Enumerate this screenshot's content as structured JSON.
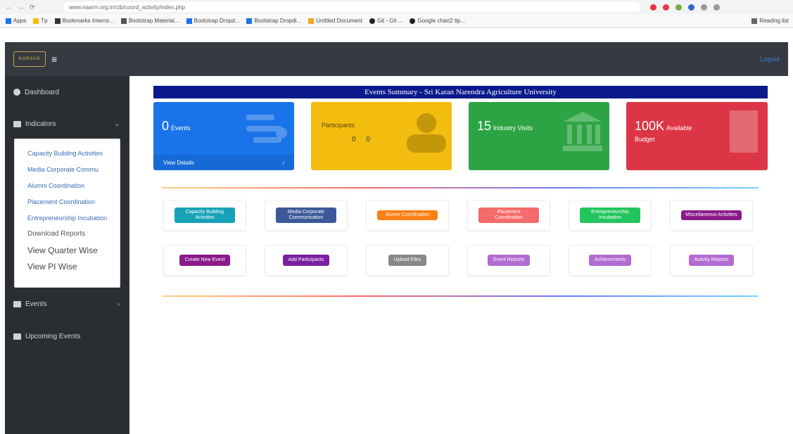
{
  "browser": {
    "url": "www.naarm.org.in/ctb/coord_activity/index.php",
    "bookmarks": [
      "Apps",
      "Tp",
      "Bookmarks Interns...",
      "Bootstrap Material...",
      "Bootstrap Dropd...",
      "Bootstrap Dropdi...",
      "Untitled Document",
      "Git - Git ...",
      "Google chart2 tip..."
    ],
    "reading_list": "Reading list"
  },
  "header": {
    "logo_text": "KARSAS",
    "logout_label": "Logout"
  },
  "sidebar": {
    "items": [
      {
        "label": "Dashboard"
      },
      {
        "label": "Indicators",
        "chevron": "⌄"
      },
      {
        "label": "Events",
        "chevron": "›"
      },
      {
        "label": "Upcoming Events"
      }
    ],
    "submenu": [
      "Capacity Building Activities",
      "Media Corporate Commu",
      "Alumni Coordination",
      "Placement Coordination",
      "Entrepreneurship Incubation",
      "Download Reports",
      "View Quarter Wise",
      "View PI Wise"
    ]
  },
  "main": {
    "banner": "Events Summary - Sri Karan Narendra Agriculture University",
    "cards": [
      {
        "num": "0",
        "label": "Events",
        "footer": "View Details",
        "footer_icon": "›"
      },
      {
        "num": "",
        "label": "Participants",
        "mini": "0 0"
      },
      {
        "num": "15",
        "label": "Industry Visits"
      },
      {
        "num": "100K",
        "label": "Available",
        "sub": "Budget"
      }
    ],
    "row1": [
      {
        "label": "Capacity Building Activities",
        "color": "#17a2b8"
      },
      {
        "label": "Media Corporate Communication",
        "color": "#3b5998"
      },
      {
        "label": "Alumni Coordination",
        "color": "#fd7e14"
      },
      {
        "label": "Placement Coordination",
        "color": "#f56a6a"
      },
      {
        "label": "Entrepreneurship Incubation",
        "color": "#22c55e"
      },
      {
        "label": "Miscellaneous Activities",
        "color": "#8b1a8b"
      }
    ],
    "row2": [
      {
        "label": "Create New Event",
        "color": "#8b1a8b"
      },
      {
        "label": "Add Participants",
        "color": "#7a1fa2"
      },
      {
        "label": "Upload Files",
        "color": "#888888"
      },
      {
        "label": "Event Reports",
        "color": "#b26bd1"
      },
      {
        "label": "Achievements",
        "color": "#b26bd1"
      },
      {
        "label": "Activity Reports",
        "color": "#b26bd1"
      }
    ]
  }
}
